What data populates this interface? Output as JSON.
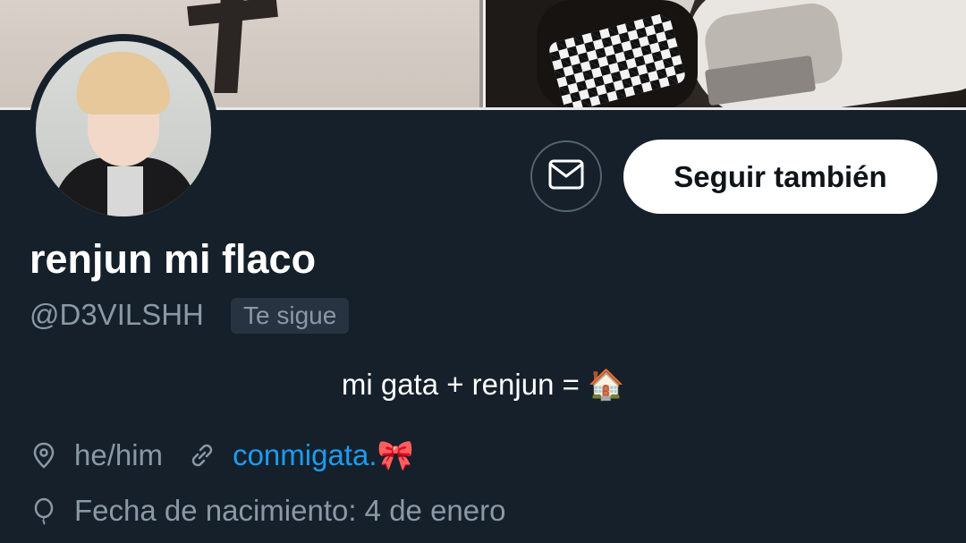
{
  "profile": {
    "display_name": "renjun mi flaco",
    "handle": "@D3VILSHH",
    "follows_you_badge": "Te sigue",
    "bio_text": "mi gata + renjun = ",
    "bio_emoji": "🏠",
    "location": "he/him",
    "website_text": "conmigata.",
    "website_emoji": "🎀",
    "birthday": "Fecha de nacimiento: 4 de enero"
  },
  "actions": {
    "follow_back_label": "Seguir también",
    "message_icon": "envelope-icon"
  },
  "colors": {
    "background": "#15202b",
    "secondary_text": "#8b98a5",
    "link": "#1d9bf0",
    "button_bg": "#ffffff",
    "button_text": "#0f1419"
  }
}
